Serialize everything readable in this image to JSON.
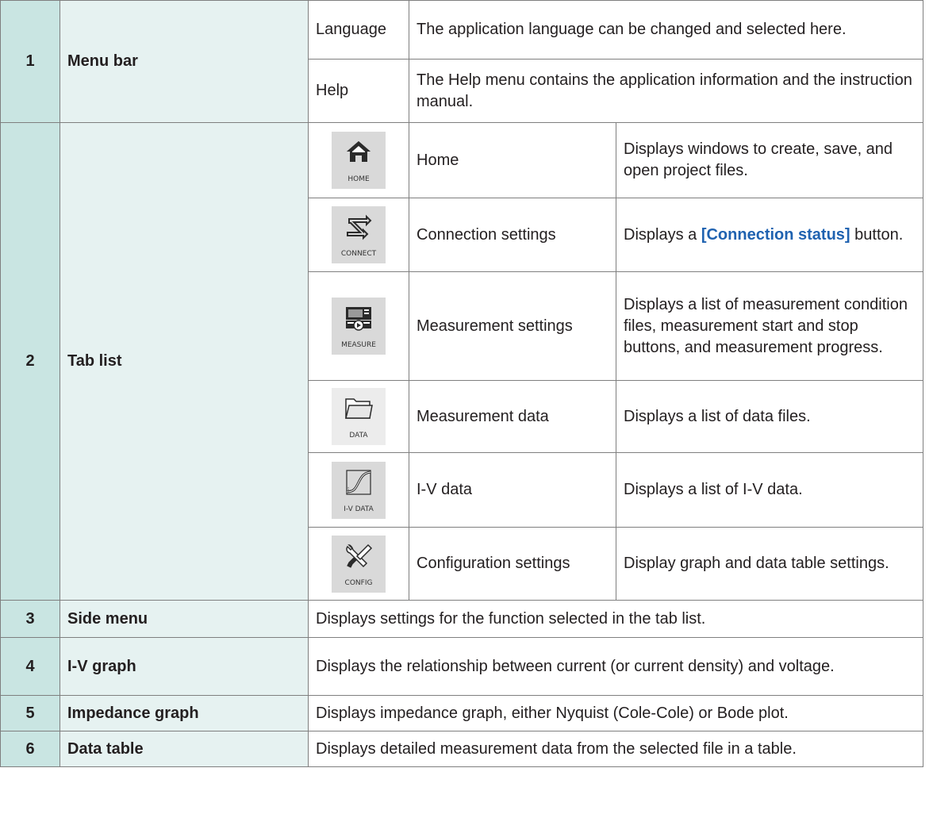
{
  "rows": [
    {
      "num": "1",
      "title": "Menu bar",
      "items": [
        {
          "name": "Language",
          "desc": "The application language can be changed and selected here."
        },
        {
          "name": "Help",
          "desc": "The Help menu contains the application information and the instruction manual."
        }
      ]
    },
    {
      "num": "2",
      "title": "Tab list",
      "tabs": [
        {
          "icon_label": "HOME",
          "icon": "home-icon",
          "name": "Home",
          "desc": "Displays windows to create, save, and open project files."
        },
        {
          "icon_label": "CONNECT",
          "icon": "connect-icon",
          "name": "Connection settings",
          "desc_prefix": "Displays a ",
          "desc_link": "[Connection status]",
          "desc_suffix": " button."
        },
        {
          "icon_label": "MEASURE",
          "icon": "measure-icon",
          "name": "Measurement settings",
          "desc": "Displays a list of measurement condition files, measurement start and stop buttons, and measurement progress."
        },
        {
          "icon_label": "DATA",
          "icon": "folder-icon",
          "name": "Measurement data",
          "desc": "Displays a list of data files."
        },
        {
          "icon_label": "I-V DATA",
          "icon": "iv-curve-icon",
          "name": "I-V data",
          "desc": "Displays a list of I-V data."
        },
        {
          "icon_label": "CONFIG",
          "icon": "tools-icon",
          "name": "Configuration settings",
          "desc": "Display graph and data table settings."
        }
      ]
    },
    {
      "num": "3",
      "title": "Side menu",
      "desc": "Displays settings for the function selected in the tab list."
    },
    {
      "num": "4",
      "title": "I-V graph",
      "desc": "Displays the relationship between current (or current density) and voltage."
    },
    {
      "num": "5",
      "title": "Impedance graph",
      "desc": "Displays impedance graph, either Nyquist (Cole-Cole) or Bode plot."
    },
    {
      "num": "6",
      "title": "Data table",
      "desc": "Displays detailed measurement data from the selected file in a table."
    }
  ],
  "colors": {
    "number_cell": "#c9e5e2",
    "title_cell": "#e6f2f1",
    "link": "#1f62b0",
    "border": "#7f7f7f",
    "icon_bg": "#d9d9d9"
  }
}
